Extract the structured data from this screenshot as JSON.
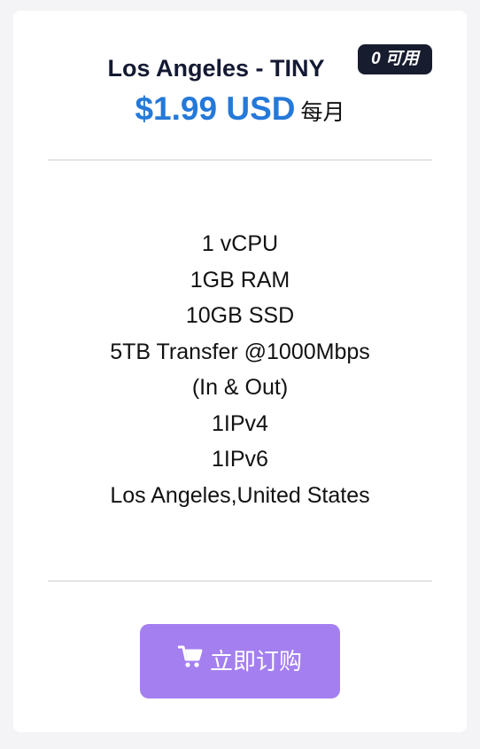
{
  "plan": {
    "title": "Los Angeles - TINY",
    "availability": "0 可用",
    "price": "$1.99 USD",
    "period": "每月"
  },
  "features": [
    "1 vCPU",
    "1GB RAM",
    "10GB SSD",
    "5TB Transfer @1000Mbps",
    "(In & Out)",
    "1IPv4",
    "1IPv6",
    "Los Angeles,United States"
  ],
  "order_button": {
    "label": "立即订购",
    "icon": "shopping-cart-icon"
  },
  "colors": {
    "price": "#2479d9",
    "badge": "#171c2e",
    "button": "#a47ff0"
  }
}
